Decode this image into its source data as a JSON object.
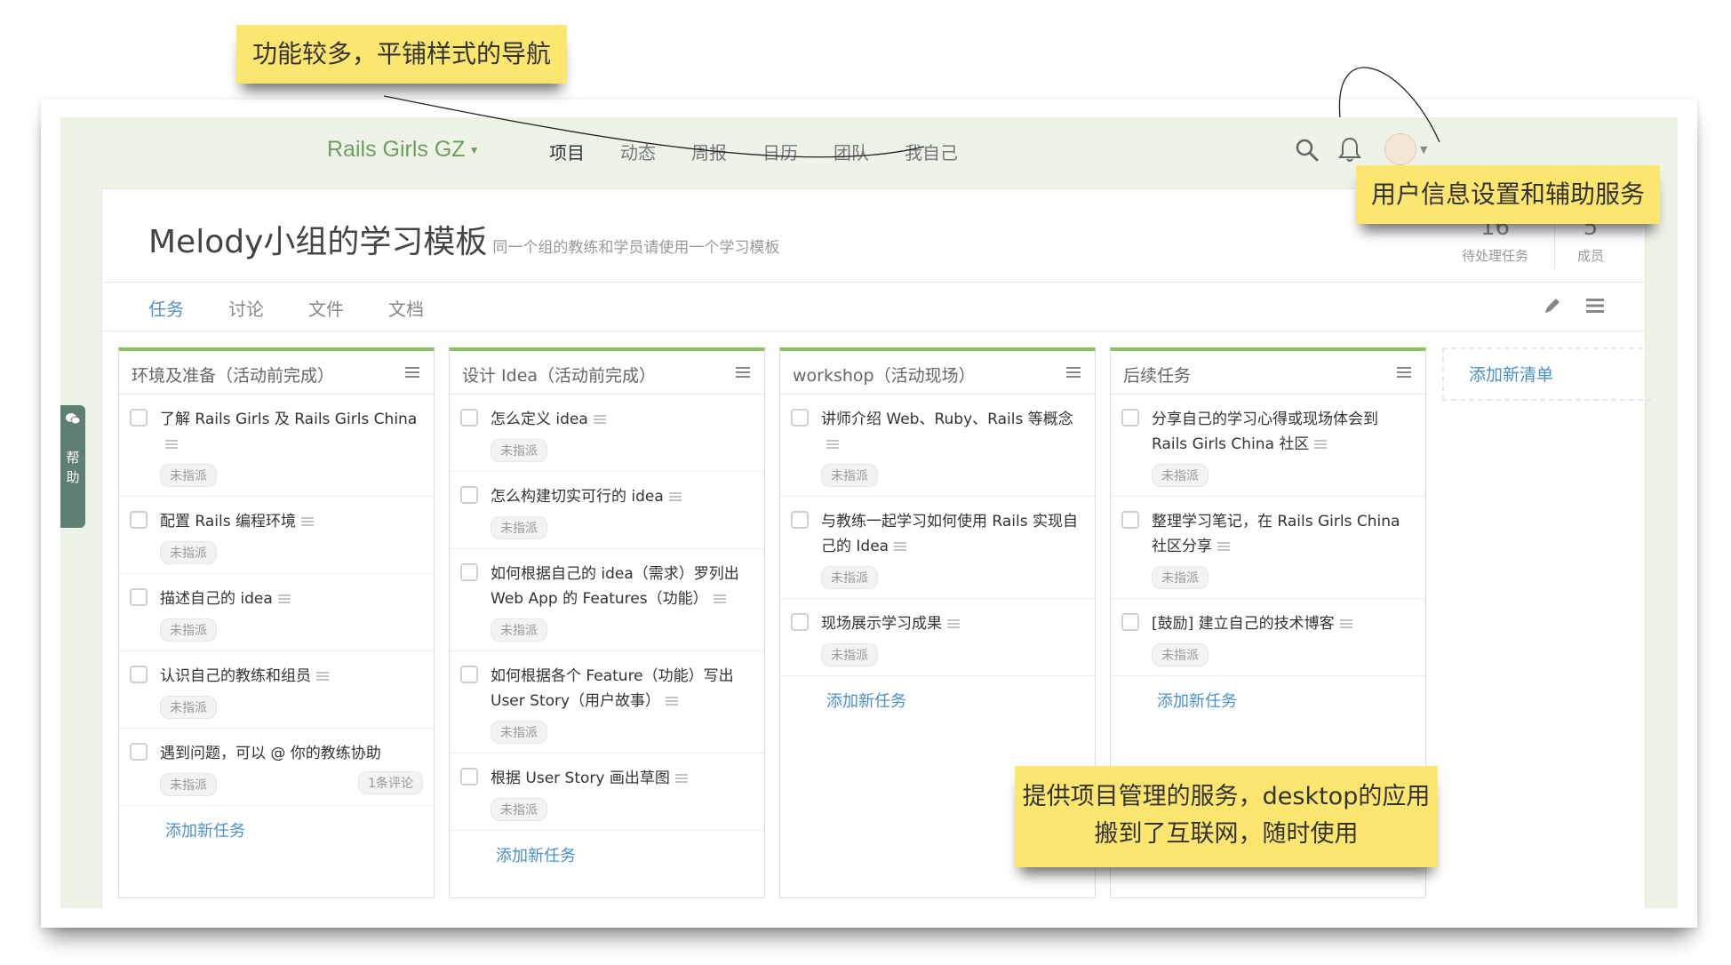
{
  "annotations": {
    "nav_note": "功能较多，平铺样式的导航",
    "user_note": "用户信息设置和辅助服务",
    "project_note_line1": "提供项目管理的服务，desktop的应用",
    "project_note_line2": "搬到了互联网，随时使用"
  },
  "topnav": {
    "brand": "Rails Girls GZ",
    "items": [
      "项目",
      "动态",
      "周报",
      "日历",
      "团队",
      "我自己"
    ],
    "active_index": 0
  },
  "project": {
    "title": "Melody小组的学习模板",
    "subtitle": "同一个组的教练和学员请使用一个学习模板",
    "stats": [
      {
        "value": "16",
        "label": "待处理任务"
      },
      {
        "value": "5",
        "label": "成员"
      }
    ],
    "tabs": [
      "任务",
      "讨论",
      "文件",
      "文档"
    ]
  },
  "lists": [
    {
      "title": "环境及准备（活动前完成）",
      "tasks": [
        {
          "text": "了解 Rails Girls 及 Rails Girls China",
          "assignee": "未指派"
        },
        {
          "text": "配置 Rails 编程环境",
          "assignee": "未指派"
        },
        {
          "text": "描述自己的 idea",
          "assignee": "未指派"
        },
        {
          "text": "认识自己的教练和组员",
          "assignee": "未指派"
        },
        {
          "text": "遇到问题，可以 @ 你的教练协助",
          "assignee": "未指派",
          "comments": "1条评论"
        }
      ],
      "add_label": "添加新任务"
    },
    {
      "title": "设计 Idea（活动前完成）",
      "tasks": [
        {
          "text": "怎么定义 idea",
          "assignee": "未指派"
        },
        {
          "text": "怎么构建切实可行的 idea",
          "assignee": "未指派"
        },
        {
          "text": "如何根据自己的 idea（需求）罗列出 Web App 的 Features（功能）",
          "assignee": "未指派"
        },
        {
          "text": "如何根据各个 Feature（功能）写出 User Story（用户故事）",
          "assignee": "未指派"
        },
        {
          "text": "根据 User Story 画出草图",
          "assignee": "未指派"
        }
      ],
      "add_label": "添加新任务"
    },
    {
      "title": "workshop（活动现场）",
      "tasks": [
        {
          "text": "讲师介绍 Web、Ruby、Rails 等概念",
          "assignee": "未指派"
        },
        {
          "text": "与教练一起学习如何使用 Rails 实现自己的 Idea",
          "assignee": "未指派"
        },
        {
          "text": "现场展示学习成果",
          "assignee": "未指派"
        }
      ],
      "add_label": "添加新任务"
    },
    {
      "title": "后续任务",
      "tasks": [
        {
          "text": "分享自己的学习心得或现场体会到 Rails Girls China 社区",
          "assignee": "未指派"
        },
        {
          "text": "整理学习笔记，在 Rails Girls China 社区分享",
          "assignee": "未指派"
        },
        {
          "text": "[鼓励] 建立自己的技术博客",
          "assignee": "未指派"
        }
      ],
      "add_label": "添加新任务"
    }
  ],
  "add_list_label": "添加新清单",
  "help_label": "帮助",
  "colors": {
    "brand_green": "#6f9d62",
    "list_accent": "#8cc063",
    "link_blue": "#4a90c8",
    "note_yellow": "#fde670"
  }
}
